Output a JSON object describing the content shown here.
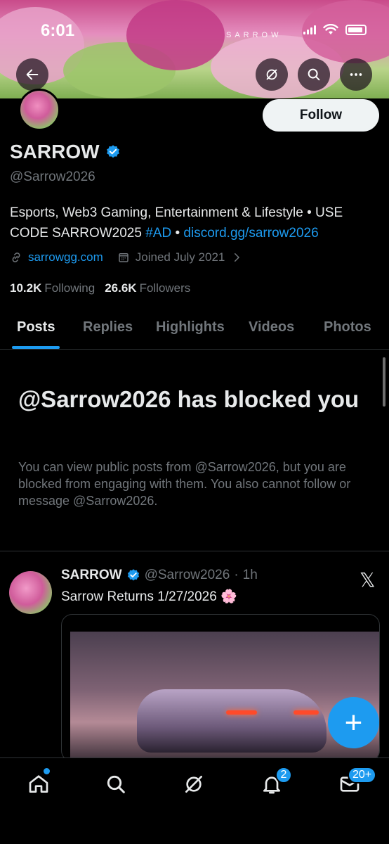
{
  "status_bar": {
    "time": "6:01"
  },
  "banner": {
    "wordmark": "SARROW"
  },
  "profile": {
    "follow_label": "Follow",
    "display_name": "SARROW",
    "handle": "@Sarrow2026",
    "bio_text": "Esports, Web3 Gaming, Entertainment & Lifestyle • USE CODE SARROW2025 ",
    "bio_hashtag": "#AD",
    "bio_separator": " • ",
    "bio_link": "discord.gg/sarrow2026",
    "website": "sarrowgg.com",
    "joined": "Joined July 2021",
    "following_count": "10.2K",
    "following_label": "Following",
    "followers_count": "26.6K",
    "followers_label": "Followers"
  },
  "tabs": [
    {
      "label": "Posts",
      "active": true
    },
    {
      "label": "Replies"
    },
    {
      "label": "Highlights"
    },
    {
      "label": "Videos"
    },
    {
      "label": "Photos"
    }
  ],
  "blocked": {
    "title": "@Sarrow2026 has blocked you",
    "body": "You can view public posts from @Sarrow2026, but you are blocked from engaging with them. You also cannot follow or message @Sarrow2026."
  },
  "post": {
    "name": "SARROW",
    "handle": "@Sarrow2026",
    "dot": "·",
    "time": "1h",
    "text": "Sarrow Returns 1/27/2026 🌸",
    "x_logo": "𝕏"
  },
  "fab": {
    "label": "+"
  },
  "bottom_nav": {
    "notifications_badge": "2",
    "messages_badge": "20+"
  },
  "icons": {
    "back": "back-arrow-icon",
    "grok": "grok-icon",
    "search": "search-icon",
    "more": "more-icon",
    "verified": "verified-badge-icon",
    "link": "link-icon",
    "calendar": "calendar-icon",
    "home": "home-icon",
    "bell": "bell-icon",
    "mail": "mail-icon"
  },
  "colors": {
    "accent": "#1d9bf0",
    "background": "#000000",
    "text_primary": "#e7e9ea",
    "text_secondary": "#71767b",
    "border": "#2f3336"
  }
}
